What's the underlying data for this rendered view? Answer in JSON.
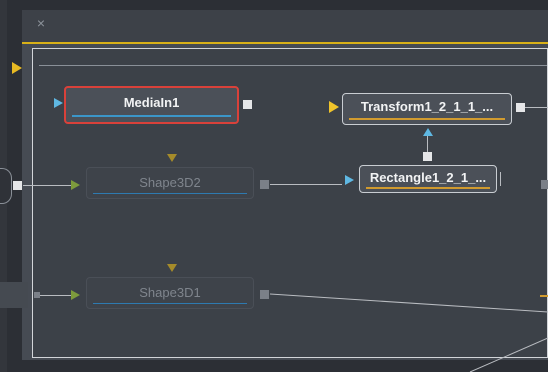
{
  "tab": {
    "close_glyph": "×"
  },
  "nodes": {
    "mediain": {
      "label": "MediaIn1"
    },
    "transform": {
      "label": "Transform1_2_1_1_..."
    },
    "rectangle": {
      "label": "Rectangle1_2_1_..."
    },
    "shape3d2": {
      "label": "Shape3D2"
    },
    "shape3d1": {
      "label": "Shape3D1"
    }
  },
  "colors": {
    "accent_yellow": "#d9b118",
    "selection_red": "#d9413a",
    "input_blue": "#5fb8e3",
    "output_orange": "#d19b2f"
  }
}
